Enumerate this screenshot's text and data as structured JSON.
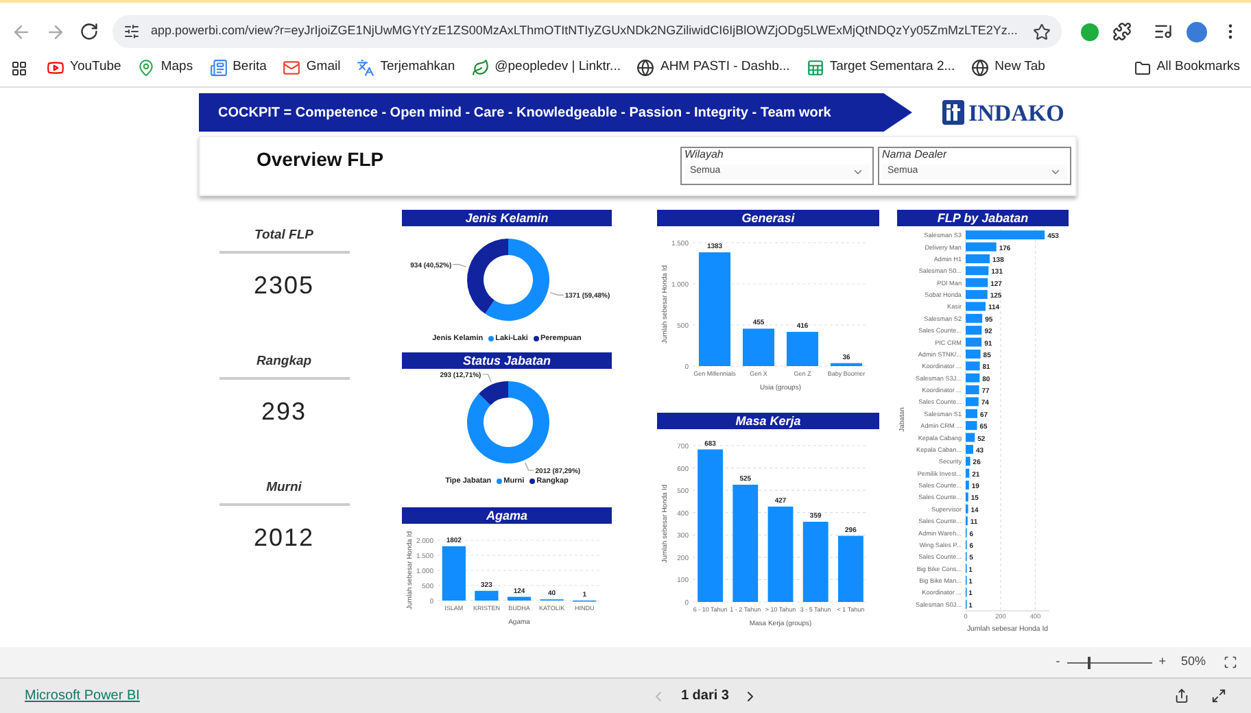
{
  "browser": {
    "url": "app.powerbi.com/view?r=eyJrIjoiZGE1NjUwMGYtYzE1ZS00MzAxLThmOTItNTIyZGUxNDk2NGZiliwidCI6IjBlOWZjODg5LWExMjQtNDQzYy05ZmMzLTE2Yz...",
    "bookmarks": [
      {
        "label": "YouTube",
        "kind": "youtube"
      },
      {
        "label": "Maps",
        "kind": "maps"
      },
      {
        "label": "Berita",
        "kind": "news"
      },
      {
        "label": "Gmail",
        "kind": "gmail"
      },
      {
        "label": "Terjemahkan",
        "kind": "translate"
      },
      {
        "label": "@peopledev | Linktr...",
        "kind": "linktree"
      },
      {
        "label": "AHM PASTI - Dashb...",
        "kind": "globe"
      },
      {
        "label": "Target Sementara 2...",
        "kind": "sheets"
      },
      {
        "label": "New Tab",
        "kind": "globe"
      }
    ],
    "all_bookmarks": "All Bookmarks"
  },
  "banner": {
    "text": "COCKPIT =  Competence - Open mind - Care - Knowledgeable - Passion - Integrity - Team work",
    "logo": "INDAKO"
  },
  "page_title": "Overview FLP",
  "slicers": [
    {
      "label": "Wilayah",
      "value": "Semua"
    },
    {
      "label": "Nama Dealer",
      "value": "Semua"
    }
  ],
  "kpis": [
    {
      "label": "Total FLP",
      "value": "2305"
    },
    {
      "label": "Rangkap",
      "value": "293"
    },
    {
      "label": "Murni",
      "value": "2012"
    }
  ],
  "jenis_kelamin": {
    "legend_title": "Jenis Kelamin",
    "chart_data": {
      "type": "donut",
      "title": "Jenis Kelamin",
      "categories": [
        "Laki-Laki",
        "Perempuan"
      ],
      "values": [
        1371,
        934
      ],
      "colors": [
        "#118dff",
        "#12239e"
      ],
      "value_labels": [
        "1371 (59,48%)",
        "934 (40,52%)"
      ]
    }
  },
  "status_jabatan": {
    "legend_title": "Tipe Jabatan",
    "chart_data": {
      "type": "donut",
      "title": "Status Jabatan",
      "categories": [
        "Murni",
        "Rangkap"
      ],
      "values": [
        2012,
        293
      ],
      "colors": [
        "#118dff",
        "#12239e"
      ],
      "value_labels": [
        "2012 (87,29%)",
        "293 (12,71%)"
      ]
    }
  },
  "agama": {
    "chart_data": {
      "type": "bar",
      "title": "Agama",
      "xlabel": "Agama",
      "ylabel": "Jumlah sebesar Honda Id",
      "categories": [
        "ISLAM",
        "KRISTEN",
        "BUDHA",
        "KATOLIK",
        "HINDU"
      ],
      "series": [
        {
          "color": "#118dff",
          "values": [
            1802,
            323,
            124,
            40,
            1
          ]
        }
      ],
      "ylim": [
        0,
        2000
      ],
      "yticks": [
        0,
        500,
        {
          "value": 1000,
          "label": "1.000"
        },
        {
          "value": 1500,
          "label": "1.500"
        },
        {
          "value": 2000,
          "label": "2.000"
        }
      ],
      "grid": true,
      "data_labels": true
    }
  },
  "generasi": {
    "chart_data": {
      "type": "bar",
      "title": "Generasi",
      "xlabel": "Usia (groups)",
      "ylabel": "Jumlah sebesar Honda Id",
      "categories": [
        "Gen Millennials",
        "Gen X",
        "Gen Z",
        "Baby Boomer"
      ],
      "series": [
        {
          "color": "#118dff",
          "values": [
            1383,
            455,
            416,
            36
          ]
        }
      ],
      "ylim": [
        0,
        1500
      ],
      "yticks": [
        0,
        500,
        {
          "value": 1000,
          "label": "1.000"
        },
        {
          "value": 1500,
          "label": "1.500"
        }
      ],
      "grid": true,
      "data_labels": true
    }
  },
  "masa_kerja": {
    "chart_data": {
      "type": "bar",
      "title": "Masa Kerja",
      "xlabel": "Masa Kerja (groups)",
      "ylabel": "Jumlah sebesar Honda Id",
      "categories": [
        "6 - 10 Tahun",
        "1 - 2 Tahun",
        "> 10 Tahun",
        "3 - 5 Tahun",
        "< 1 Tahun"
      ],
      "series": [
        {
          "color": "#118dff",
          "values": [
            683,
            525,
            427,
            359,
            296
          ]
        }
      ],
      "ylim": [
        0,
        700
      ],
      "yticks": [
        0,
        100,
        200,
        300,
        400,
        500,
        600,
        700
      ],
      "grid": true,
      "data_labels": true
    }
  },
  "flp_by_jabatan": {
    "chart_data": {
      "type": "bar",
      "orientation": "horizontal",
      "title": "FLP by Jabatan",
      "xlabel": "Jumlah sebesar Honda Id",
      "ylabel": "Jabatan",
      "categories": [
        "Salesman S3",
        "Delivery Man",
        "Admin H1",
        "Salesman S0...",
        "PDI Man",
        "Sobat Honda",
        "Kasir",
        "Salesman S2",
        "Sales Counte...",
        "PIC CRM",
        "Admin STNK/...",
        "Koordinator ...",
        "Salesman S3J...",
        "Koordinator ...",
        "Sales Counte...",
        "Salesman S1",
        "Admin CRM ...",
        "Kepala Cabang",
        "Kepala Caban...",
        "Security",
        "Pemilik Invest...",
        "Sales Counte...",
        "Sales Counte...",
        "Supervisor",
        "Sales Counte...",
        "Admin Wareh...",
        "Wing Sales P...",
        "Sales Counte...",
        "Big Bike Cons...",
        "Big Bike Man...",
        "Koordinator ...",
        "Salesman S0J..."
      ],
      "series": [
        {
          "color": "#118dff",
          "values": [
            453,
            176,
            138,
            131,
            127,
            125,
            114,
            95,
            92,
            91,
            85,
            81,
            80,
            77,
            74,
            67,
            65,
            52,
            43,
            26,
            21,
            19,
            15,
            14,
            11,
            6,
            6,
            5,
            1,
            1,
            1,
            1
          ]
        }
      ],
      "xlim": [
        0,
        480
      ],
      "xticks": [
        0,
        200,
        400
      ],
      "grid": true,
      "data_labels": true
    }
  },
  "zoom": {
    "minus": "-",
    "plus": "+",
    "level": 0.25,
    "reading": "50%"
  },
  "footer": {
    "brand": "Microsoft Power BI",
    "page": "1 dari 3"
  }
}
